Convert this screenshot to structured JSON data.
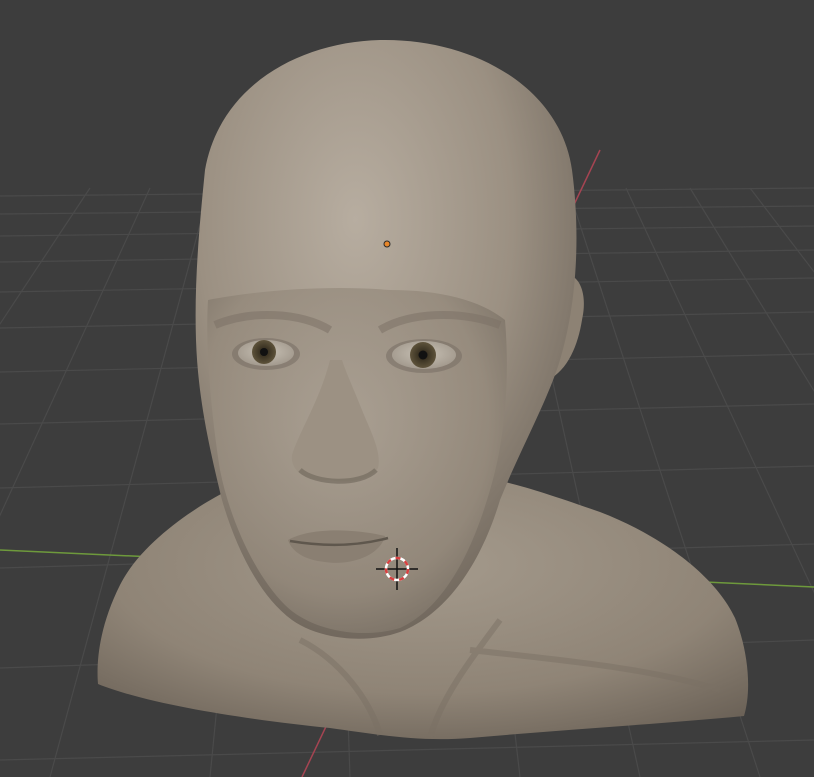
{
  "viewport": {
    "background": "#3d3d3d",
    "grid_color": "#4a4a4a",
    "x_axis_color": "#6e9a3c",
    "y_axis_color": "#a54452"
  },
  "scene": {
    "model": "sculpted-head-bust",
    "skin_color": "#938878",
    "iris_color": "#4d4430"
  },
  "overlays": {
    "origin_color": "#e8872a",
    "cursor_ring_colors": [
      "#d94040",
      "#ffffff"
    ]
  }
}
